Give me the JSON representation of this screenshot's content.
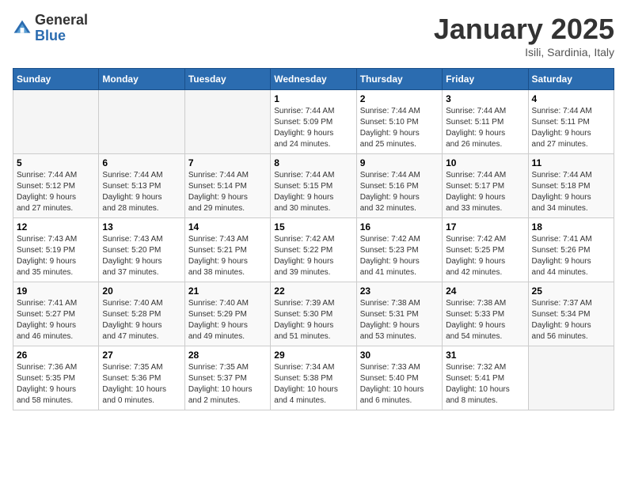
{
  "header": {
    "logo_general": "General",
    "logo_blue": "Blue",
    "month_title": "January 2025",
    "location": "Isili, Sardinia, Italy"
  },
  "days_of_week": [
    "Sunday",
    "Monday",
    "Tuesday",
    "Wednesday",
    "Thursday",
    "Friday",
    "Saturday"
  ],
  "weeks": [
    [
      {
        "day": "",
        "info": ""
      },
      {
        "day": "",
        "info": ""
      },
      {
        "day": "",
        "info": ""
      },
      {
        "day": "1",
        "info": "Sunrise: 7:44 AM\nSunset: 5:09 PM\nDaylight: 9 hours\nand 24 minutes."
      },
      {
        "day": "2",
        "info": "Sunrise: 7:44 AM\nSunset: 5:10 PM\nDaylight: 9 hours\nand 25 minutes."
      },
      {
        "day": "3",
        "info": "Sunrise: 7:44 AM\nSunset: 5:11 PM\nDaylight: 9 hours\nand 26 minutes."
      },
      {
        "day": "4",
        "info": "Sunrise: 7:44 AM\nSunset: 5:11 PM\nDaylight: 9 hours\nand 27 minutes."
      }
    ],
    [
      {
        "day": "5",
        "info": "Sunrise: 7:44 AM\nSunset: 5:12 PM\nDaylight: 9 hours\nand 27 minutes."
      },
      {
        "day": "6",
        "info": "Sunrise: 7:44 AM\nSunset: 5:13 PM\nDaylight: 9 hours\nand 28 minutes."
      },
      {
        "day": "7",
        "info": "Sunrise: 7:44 AM\nSunset: 5:14 PM\nDaylight: 9 hours\nand 29 minutes."
      },
      {
        "day": "8",
        "info": "Sunrise: 7:44 AM\nSunset: 5:15 PM\nDaylight: 9 hours\nand 30 minutes."
      },
      {
        "day": "9",
        "info": "Sunrise: 7:44 AM\nSunset: 5:16 PM\nDaylight: 9 hours\nand 32 minutes."
      },
      {
        "day": "10",
        "info": "Sunrise: 7:44 AM\nSunset: 5:17 PM\nDaylight: 9 hours\nand 33 minutes."
      },
      {
        "day": "11",
        "info": "Sunrise: 7:44 AM\nSunset: 5:18 PM\nDaylight: 9 hours\nand 34 minutes."
      }
    ],
    [
      {
        "day": "12",
        "info": "Sunrise: 7:43 AM\nSunset: 5:19 PM\nDaylight: 9 hours\nand 35 minutes."
      },
      {
        "day": "13",
        "info": "Sunrise: 7:43 AM\nSunset: 5:20 PM\nDaylight: 9 hours\nand 37 minutes."
      },
      {
        "day": "14",
        "info": "Sunrise: 7:43 AM\nSunset: 5:21 PM\nDaylight: 9 hours\nand 38 minutes."
      },
      {
        "day": "15",
        "info": "Sunrise: 7:42 AM\nSunset: 5:22 PM\nDaylight: 9 hours\nand 39 minutes."
      },
      {
        "day": "16",
        "info": "Sunrise: 7:42 AM\nSunset: 5:23 PM\nDaylight: 9 hours\nand 41 minutes."
      },
      {
        "day": "17",
        "info": "Sunrise: 7:42 AM\nSunset: 5:25 PM\nDaylight: 9 hours\nand 42 minutes."
      },
      {
        "day": "18",
        "info": "Sunrise: 7:41 AM\nSunset: 5:26 PM\nDaylight: 9 hours\nand 44 minutes."
      }
    ],
    [
      {
        "day": "19",
        "info": "Sunrise: 7:41 AM\nSunset: 5:27 PM\nDaylight: 9 hours\nand 46 minutes."
      },
      {
        "day": "20",
        "info": "Sunrise: 7:40 AM\nSunset: 5:28 PM\nDaylight: 9 hours\nand 47 minutes."
      },
      {
        "day": "21",
        "info": "Sunrise: 7:40 AM\nSunset: 5:29 PM\nDaylight: 9 hours\nand 49 minutes."
      },
      {
        "day": "22",
        "info": "Sunrise: 7:39 AM\nSunset: 5:30 PM\nDaylight: 9 hours\nand 51 minutes."
      },
      {
        "day": "23",
        "info": "Sunrise: 7:38 AM\nSunset: 5:31 PM\nDaylight: 9 hours\nand 53 minutes."
      },
      {
        "day": "24",
        "info": "Sunrise: 7:38 AM\nSunset: 5:33 PM\nDaylight: 9 hours\nand 54 minutes."
      },
      {
        "day": "25",
        "info": "Sunrise: 7:37 AM\nSunset: 5:34 PM\nDaylight: 9 hours\nand 56 minutes."
      }
    ],
    [
      {
        "day": "26",
        "info": "Sunrise: 7:36 AM\nSunset: 5:35 PM\nDaylight: 9 hours\nand 58 minutes."
      },
      {
        "day": "27",
        "info": "Sunrise: 7:35 AM\nSunset: 5:36 PM\nDaylight: 10 hours\nand 0 minutes."
      },
      {
        "day": "28",
        "info": "Sunrise: 7:35 AM\nSunset: 5:37 PM\nDaylight: 10 hours\nand 2 minutes."
      },
      {
        "day": "29",
        "info": "Sunrise: 7:34 AM\nSunset: 5:38 PM\nDaylight: 10 hours\nand 4 minutes."
      },
      {
        "day": "30",
        "info": "Sunrise: 7:33 AM\nSunset: 5:40 PM\nDaylight: 10 hours\nand 6 minutes."
      },
      {
        "day": "31",
        "info": "Sunrise: 7:32 AM\nSunset: 5:41 PM\nDaylight: 10 hours\nand 8 minutes."
      },
      {
        "day": "",
        "info": ""
      }
    ]
  ]
}
